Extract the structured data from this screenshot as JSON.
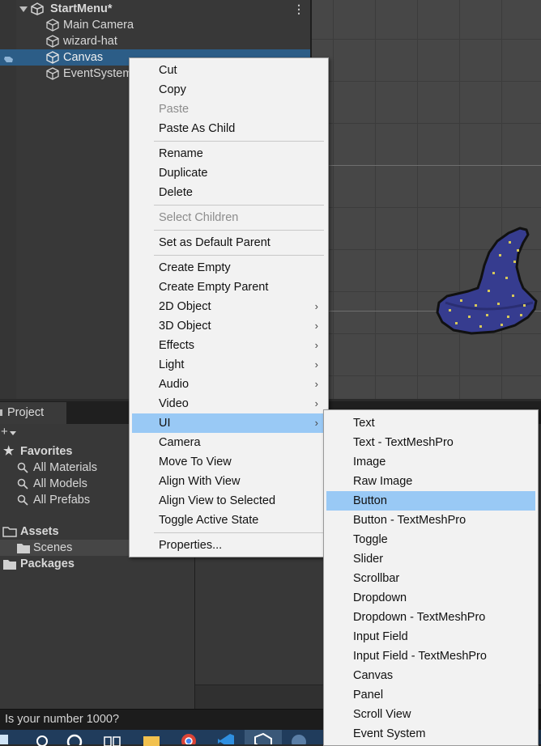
{
  "hierarchy": {
    "scene_title": "StartMenu*",
    "items": [
      {
        "label": "Main Camera"
      },
      {
        "label": "wizard-hat"
      },
      {
        "label": "Canvas"
      },
      {
        "label": "EventSystem"
      }
    ]
  },
  "project": {
    "tab_label": "Project",
    "favorites": {
      "label": "Favorites",
      "items": [
        {
          "label": "All Materials"
        },
        {
          "label": "All Models"
        },
        {
          "label": "All Prefabs"
        }
      ]
    },
    "assets": {
      "label": "Assets",
      "items": [
        {
          "label": "Scenes"
        }
      ]
    },
    "packages": {
      "label": "Packages"
    }
  },
  "status": {
    "text": "Is your number 1000?"
  },
  "context_menu": {
    "items": [
      {
        "label": "Cut"
      },
      {
        "label": "Copy"
      },
      {
        "label": "Paste"
      },
      {
        "label": "Paste As Child"
      },
      {
        "label": "Rename"
      },
      {
        "label": "Duplicate"
      },
      {
        "label": "Delete"
      },
      {
        "label": "Select Children"
      },
      {
        "label": "Set as Default Parent"
      },
      {
        "label": "Create Empty"
      },
      {
        "label": "Create Empty Parent"
      },
      {
        "label": "2D Object"
      },
      {
        "label": "3D Object"
      },
      {
        "label": "Effects"
      },
      {
        "label": "Light"
      },
      {
        "label": "Audio"
      },
      {
        "label": "Video"
      },
      {
        "label": "UI"
      },
      {
        "label": "Camera"
      },
      {
        "label": "Move To View"
      },
      {
        "label": "Align With View"
      },
      {
        "label": "Align View to Selected"
      },
      {
        "label": "Toggle Active State"
      },
      {
        "label": "Properties..."
      }
    ]
  },
  "ui_submenu": {
    "items": [
      {
        "label": "Text"
      },
      {
        "label": "Text - TextMeshPro"
      },
      {
        "label": "Image"
      },
      {
        "label": "Raw Image"
      },
      {
        "label": "Button"
      },
      {
        "label": "Button - TextMeshPro"
      },
      {
        "label": "Toggle"
      },
      {
        "label": "Slider"
      },
      {
        "label": "Scrollbar"
      },
      {
        "label": "Dropdown"
      },
      {
        "label": "Dropdown - TextMeshPro"
      },
      {
        "label": "Input Field"
      },
      {
        "label": "Input Field - TextMeshPro"
      },
      {
        "label": "Canvas"
      },
      {
        "label": "Panel"
      },
      {
        "label": "Scroll View"
      },
      {
        "label": "Event System"
      }
    ]
  },
  "colors": {
    "selection": "#2c5d87",
    "menu_highlight": "#99c9f5",
    "menu_background": "#f2f2f2",
    "hat_body": "#3a3f8c",
    "hat_stars": "#d6c85a"
  }
}
